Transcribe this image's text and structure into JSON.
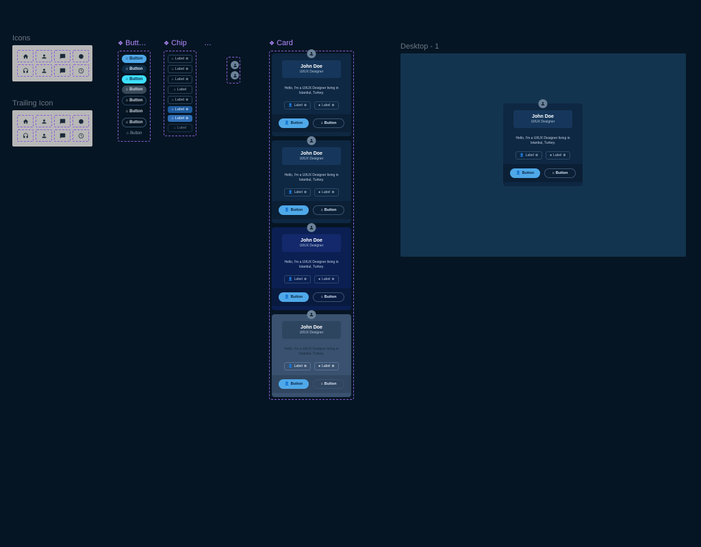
{
  "icons_section": {
    "title": "Icons"
  },
  "trailing_section": {
    "title": "Trailing Icon"
  },
  "buttons_section": {
    "title": "Butt…",
    "label": "Button"
  },
  "chip_section": {
    "title": "Chip",
    "label": "Label"
  },
  "misc_section": {
    "title": "…"
  },
  "card_section": {
    "title": "Card",
    "name": "John Doe",
    "role": "UI/UX Designer",
    "bio": "Hello, I'm a UI/UX Designer living in Istanbul, Turkey.",
    "chip_label": "Label",
    "btn_label": "Button"
  },
  "desktop": {
    "title": "Desktop - 1"
  }
}
